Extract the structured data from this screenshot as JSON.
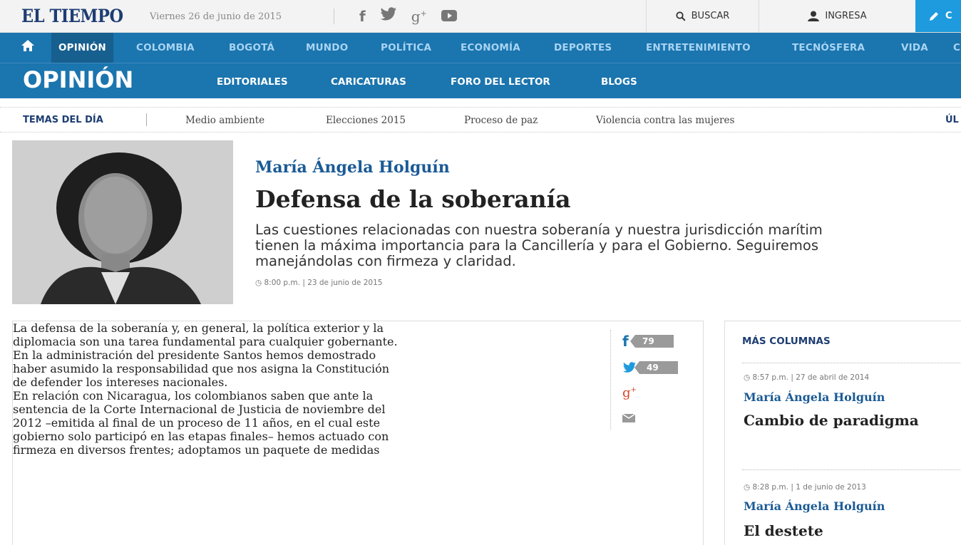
{
  "header": {
    "logo": "EL TIEMPO",
    "date": "Viernes 26 de junio de 2015",
    "social_icons": [
      "facebook-icon",
      "twitter-icon",
      "google-plus-icon",
      "youtube-icon"
    ],
    "search_label": "BUSCAR",
    "login_label": "INGRESA",
    "blue_button_label": "C"
  },
  "nav": {
    "items": [
      "OPINIÓN",
      "COLOMBIA",
      "BOGOTÁ",
      "MUNDO",
      "POLÍTICA",
      "ECONOMÍA",
      "DEPORTES",
      "ENTRETENIMIENTO",
      "TECNÓSFERA",
      "VIDA",
      "C"
    ],
    "active": "OPINIÓN"
  },
  "section": {
    "title": "OPINIÓN",
    "subnav": [
      "EDITORIALES",
      "CARICATURAS",
      "FORO DEL LECTOR",
      "BLOGS"
    ]
  },
  "topics": {
    "label": "TEMAS DEL DÍA",
    "items": [
      "Medio ambiente",
      "Elecciones 2015",
      "Proceso de paz",
      "Violencia contra las mujeres"
    ],
    "right_label": "ÚL"
  },
  "hero": {
    "author": "María Ángela Holguín",
    "title": "Defensa de la soberanía",
    "lead_lines": [
      "Las cuestiones relacionadas con nuestra soberanía y nuestra jurisdicción marítim",
      "tienen la máxima importancia para la Cancillería y para el Gobierno. Seguiremos",
      "manejándolas con firmeza y claridad."
    ],
    "timestamp": "8:00 p.m. | 23 de junio de 2015"
  },
  "article": {
    "p1": [
      "La defensa de la soberanía y, en general, la política exterior y la",
      "diplomacia son una tarea fundamental para cualquier gobernante.",
      "En la administración del presidente Santos hemos demostrado",
      "haber asumido la responsabilidad que nos asigna la Constitución",
      "de defender los intereses nacionales."
    ],
    "p2": [
      "En relación con Nicaragua, los colombianos saben que ante la",
      "sentencia de la Corte Internacional de Justicia de noviembre del",
      "2012 –emitida al final de un proceso de 11 años, en el cual este",
      "gobierno solo participó en las etapas finales– hemos actuado con",
      "firmeza en diversos frentes; adoptamos un paquete de medidas"
    ]
  },
  "share": {
    "facebook_count": "79",
    "twitter_count": "49"
  },
  "sidebar": {
    "heading": "MÁS COLUMNAS",
    "columns": [
      {
        "time": "8:57 p.m. | 27 de abril de 2014",
        "author": "María Ángela Holguín",
        "title": "Cambio de paradigma"
      },
      {
        "time": "8:28 p.m. | 1 de junio de 2013",
        "author": "María Ángela Holguín",
        "title": "El destete"
      }
    ]
  }
}
